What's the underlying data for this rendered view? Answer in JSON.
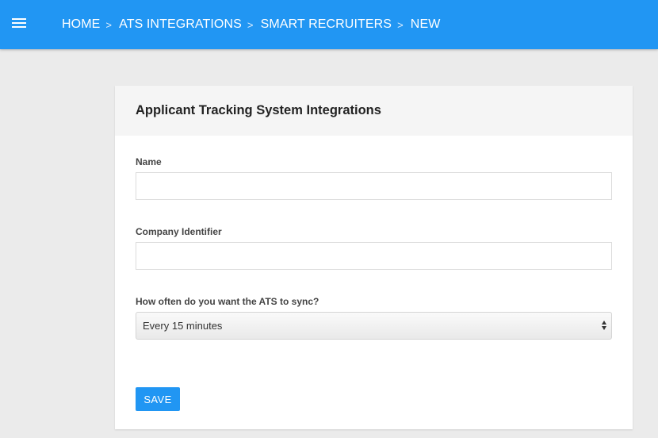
{
  "header": {
    "breadcrumbs": [
      {
        "label": "HOME"
      },
      {
        "label": "ATS INTEGRATIONS"
      },
      {
        "label": "SMART RECRUITERS"
      },
      {
        "label": "NEW"
      }
    ],
    "separator": ">"
  },
  "card": {
    "title": "Applicant Tracking System Integrations",
    "fields": {
      "name": {
        "label": "Name",
        "value": ""
      },
      "company_identifier": {
        "label": "Company Identifier",
        "value": ""
      },
      "sync_frequency": {
        "label": "How often do you want the ATS to sync?",
        "selected": "Every 15 minutes"
      }
    },
    "save_label": "SAVE"
  },
  "colors": {
    "accent": "#2196f3",
    "background": "#ebebeb",
    "card_header": "#f5f5f5"
  }
}
